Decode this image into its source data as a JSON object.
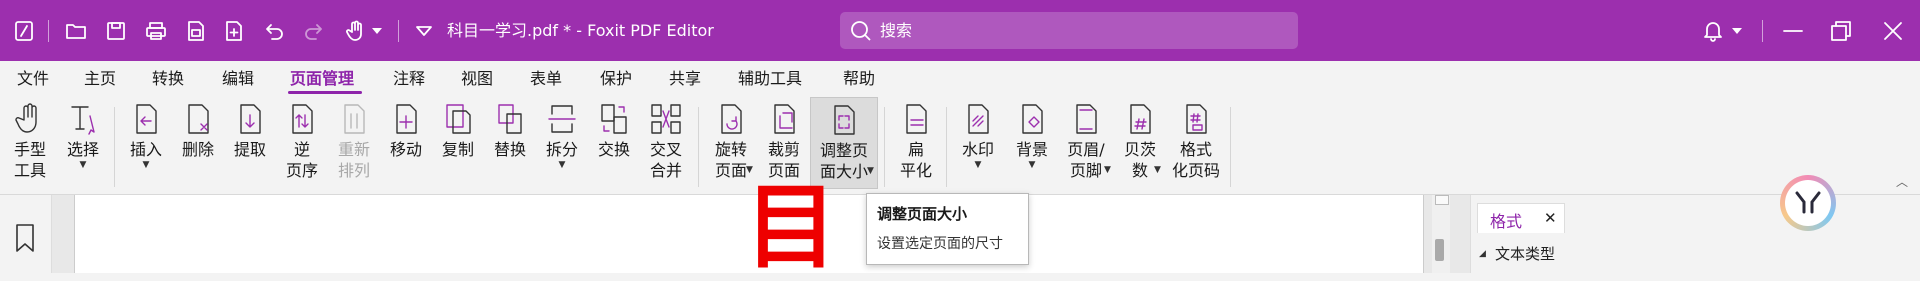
{
  "app": {
    "document_title": "科目一学习.pdf * - Foxit PDF Editor",
    "accent_color": "#9c2fae"
  },
  "search": {
    "placeholder": "搜索"
  },
  "quick_access": [
    "foxit-logo-icon",
    "open-folder-icon",
    "save-icon",
    "print-icon",
    "create-pdf-icon",
    "new-page-icon",
    "undo-icon",
    "redo-icon",
    "hand-tool-icon",
    "chevron-down-icon",
    "chevron-down-icon"
  ],
  "window_controls": [
    "bell-icon",
    "chevron-down-icon",
    "minimize-icon",
    "restore-icon",
    "close-icon"
  ],
  "menu": [
    {
      "label": "文件"
    },
    {
      "label": "主页"
    },
    {
      "label": "转换"
    },
    {
      "label": "编辑"
    },
    {
      "label": "页面管理",
      "active": true
    },
    {
      "label": "注释"
    },
    {
      "label": "视图"
    },
    {
      "label": "表单"
    },
    {
      "label": "保护"
    },
    {
      "label": "共享"
    },
    {
      "label": "辅助工具"
    },
    {
      "label": "帮助"
    }
  ],
  "ribbon": {
    "hand_tool": "手型\n工具",
    "select": "选择",
    "insert": "插入",
    "delete": "删除",
    "extract": "提取",
    "reverse": "逆\n页序",
    "rearrange": "重新\n排列",
    "move": "移动",
    "copy": "复制",
    "replace": "替换",
    "split": "拆分",
    "swap": "交换",
    "interleave": "交叉\n合并",
    "rotate": "旋转\n页面",
    "crop": "裁剪\n页面",
    "resize": "调整页\n面大小",
    "flatten": "扁\n平化",
    "watermark": "水印",
    "background": "背景",
    "header_footer": "页眉/\n页脚",
    "bates": "贝茨\n数",
    "format_page_number": "格式\n化页码"
  },
  "tooltip": {
    "title": "调整页面大小",
    "description": "设置选定页面的尺寸"
  },
  "side_panel": {
    "tab_label": "格式",
    "section_label": "文本类型"
  },
  "document_glyph": "目"
}
